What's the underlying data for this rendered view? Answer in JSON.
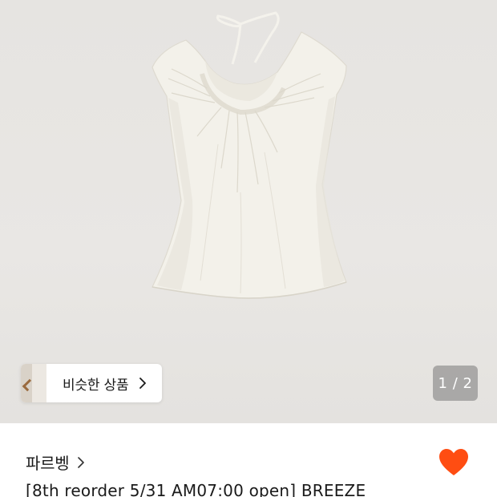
{
  "gallery": {
    "image_alt": "ivory sleeveless blouse with gathered scoop neckline and neck tie",
    "page_current": "1",
    "page_total": "2",
    "page_separator": "/",
    "indicator_text": "1 / 2",
    "similar_button_label": "비슷한 상품",
    "background_color": "#e7e5e2"
  },
  "product": {
    "brand": "파르벵",
    "title": "[8th reorder 5/31 AM07:00 open] BREEZE",
    "liked": true,
    "like_color": "#ff4d12"
  },
  "icons": {
    "similar_chevron": "chevron-right-icon",
    "brand_chevron": "chevron-right-icon",
    "like": "heart-icon"
  }
}
